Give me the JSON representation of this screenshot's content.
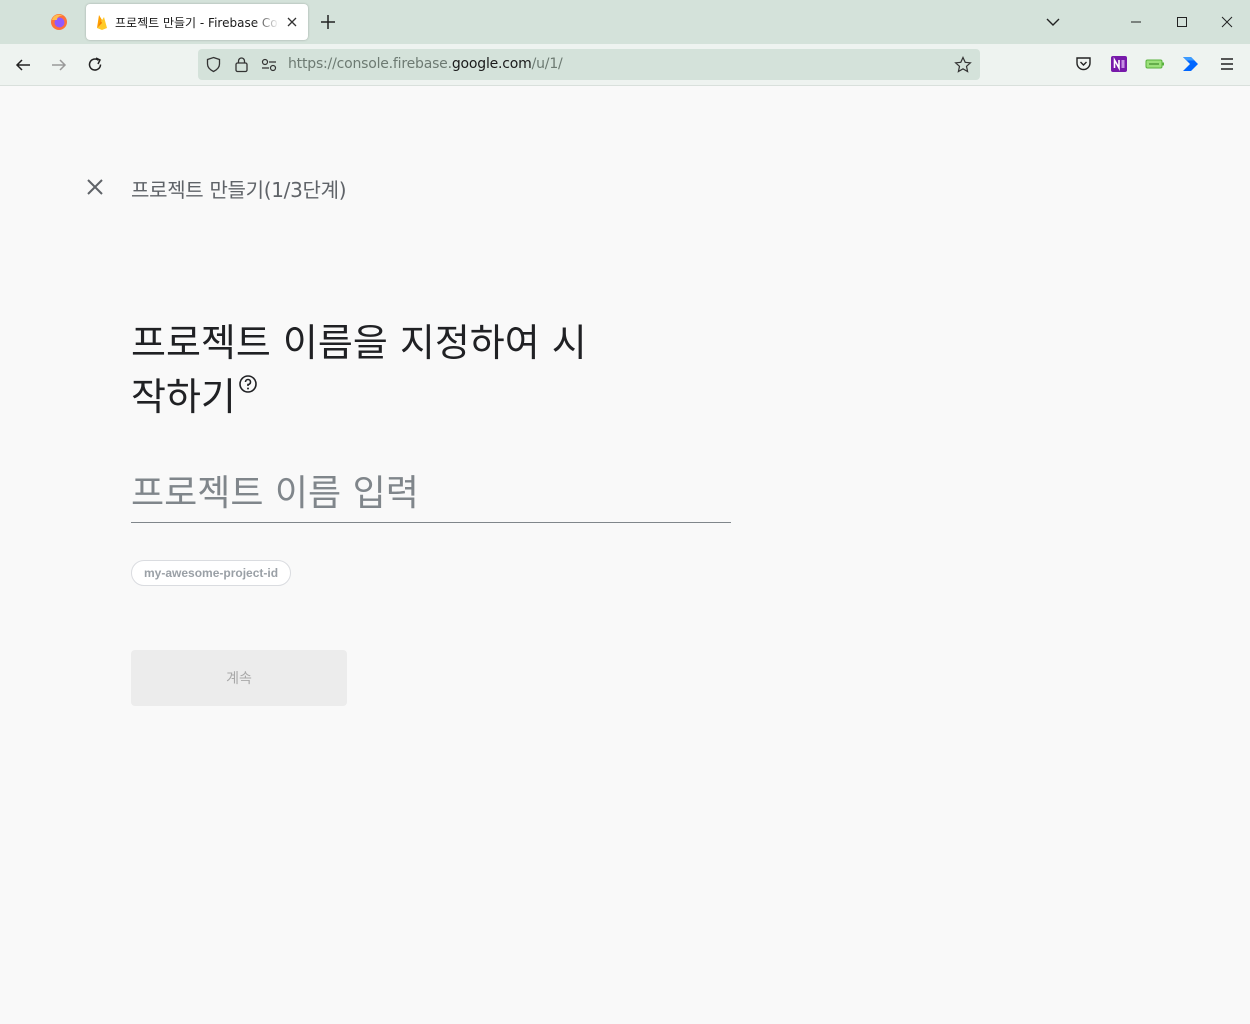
{
  "browser": {
    "tab": {
      "title": "프로젝트 만들기 - Firebase Console"
    },
    "url": {
      "scheme_and_path_prefix": "https://console.firebase.",
      "domain": "google.com",
      "path": "/u/1/"
    }
  },
  "page": {
    "step_title": "프로젝트 만들기(1/3단계)",
    "heading_line1": "프로젝트 이름을 지정하여 시",
    "heading_line2": "작하기",
    "name_input": {
      "placeholder": "프로젝트 이름 입력",
      "value": ""
    },
    "project_id_chip": "my-awesome-project-id",
    "continue_label": "계속"
  },
  "colors": {
    "tab_strip": "#d4e2da",
    "page_background": "#f9f9f9",
    "disabled_button": "#ececec"
  }
}
